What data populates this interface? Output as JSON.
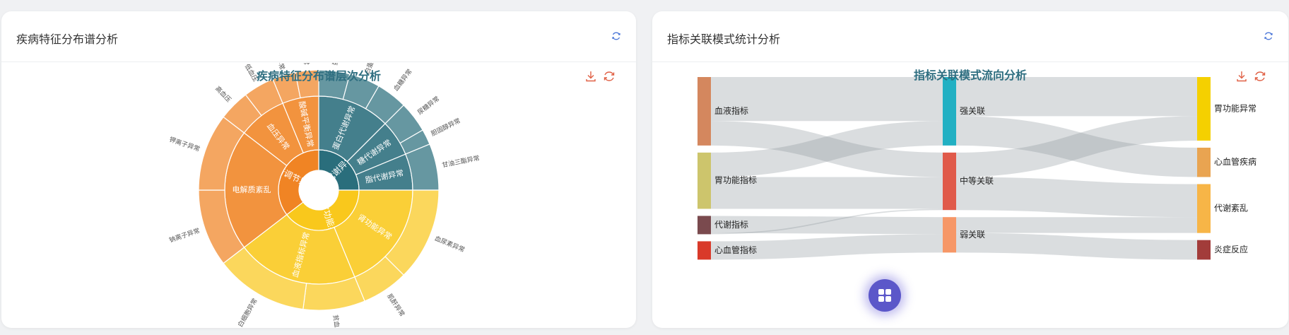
{
  "panels": {
    "left": {
      "title": "疾病特征分布谱分析"
    },
    "right": {
      "title": "指标关联模式统计分析"
    }
  },
  "icons": {
    "refresh": "refresh-icon",
    "download": "download-icon",
    "restore": "restore-icon",
    "apps": "apps-grid-icon"
  },
  "colors": {
    "accent": "#4a76d8",
    "toolbar_icon": "#e06045",
    "chart_title": "#2e6e80"
  },
  "chart_data": [
    {
      "type": "sunburst",
      "title": "疾病特征分布谱层次分析",
      "children": [
        {
          "name": "代谢异常",
          "color": "#2a6e7c",
          "value": 6,
          "children": [
            {
              "name": "蛋白代谢异常",
              "value": 3,
              "children": [
                {
                  "name": "蛋白尿",
                  "value": 1
                },
                {
                  "name": "白蛋白异常",
                  "value": 1
                },
                {
                  "name": "血糖异常",
                  "value": 1
                }
              ]
            },
            {
              "name": "糖代谢异常",
              "value": 1.5,
              "children": [
                {
                  "name": "尿糖异常",
                  "value": 1
                },
                {
                  "name": "胆固醇异常",
                  "value": 0.5
                }
              ]
            },
            {
              "name": "脂代谢异常",
              "value": 1.5,
              "children": [
                {
                  "name": "甘油三酯异常",
                  "value": 1.5
                }
              ]
            }
          ]
        },
        {
          "name": "器官功能异常",
          "color": "#f9c81c",
          "value": 9.5,
          "children": [
            {
              "name": "肾功能异常",
              "value": 4.5,
              "children": [
                {
                  "name": "血尿素异常",
                  "value": 3
                },
                {
                  "name": "肌酐异常",
                  "value": 1.5
                }
              ]
            },
            {
              "name": "血液指标异常",
              "value": 5,
              "children": [
                {
                  "name": "贫血",
                  "value": 2
                },
                {
                  "name": "白细胞异常",
                  "value": 3
                }
              ]
            }
          ]
        },
        {
          "name": "平衡调节异常",
          "color": "#f08424",
          "value": 8.5,
          "children": [
            {
              "name": "电解质紊乱",
              "value": 5,
              "children": [
                {
                  "name": "钠离子异常",
                  "value": 2.5
                },
                {
                  "name": "钾离子异常",
                  "value": 2.5
                }
              ]
            },
            {
              "name": "血压异常",
              "value": 2,
              "children": [
                {
                  "name": "高血压",
                  "value": 1
                },
                {
                  "name": "低血压",
                  "value": 1
                }
              ]
            },
            {
              "name": "酸碱平衡异常",
              "value": 1.5,
              "children": [
                {
                  "name": "pH异常",
                  "value": 0.75
                },
                {
                  "name": "碳酸异常",
                  "value": 0.75
                }
              ]
            }
          ]
        }
      ]
    },
    {
      "type": "sankey",
      "title": "指标关联模式流向分析",
      "nodes": [
        {
          "name": "血液指标",
          "color": "#d4875e",
          "column": 0
        },
        {
          "name": "胃功能指标",
          "color": "#cdc56c",
          "column": 0
        },
        {
          "name": "代谢指标",
          "color": "#7a4a4e",
          "column": 0
        },
        {
          "name": "心血管指标",
          "color": "#d93a2a",
          "column": 0
        },
        {
          "name": "强关联",
          "color": "#22b0c3",
          "column": 1
        },
        {
          "name": "中等关联",
          "color": "#e05a4a",
          "column": 1
        },
        {
          "name": "弱关联",
          "color": "#f69767",
          "column": 1
        },
        {
          "name": "胃功能异常",
          "color": "#f5d000",
          "column": 2
        },
        {
          "name": "心血管疾病",
          "color": "#e9a451",
          "column": 2
        },
        {
          "name": "代谢紊乱",
          "color": "#f7b547",
          "column": 2
        },
        {
          "name": "炎症反应",
          "color": "#a23c3a",
          "column": 2
        }
      ],
      "links": [
        {
          "source": "血液指标",
          "target": "强关联",
          "value": 36
        },
        {
          "source": "血液指标",
          "target": "中等关联",
          "value": 20
        },
        {
          "source": "胃功能指标",
          "target": "强关联",
          "value": 20
        },
        {
          "source": "胃功能指标",
          "target": "中等关联",
          "value": 26
        },
        {
          "source": "代谢指标",
          "target": "弱关联",
          "value": 14
        },
        {
          "source": "代谢指标",
          "target": "中等关联",
          "value": 1
        },
        {
          "source": "心血管指标",
          "target": "弱关联",
          "value": 15
        },
        {
          "source": "强关联",
          "target": "胃功能异常",
          "value": 32
        },
        {
          "source": "强关联",
          "target": "心血管疾病",
          "value": 24
        },
        {
          "source": "中等关联",
          "target": "胃功能异常",
          "value": 20
        },
        {
          "source": "中等关联",
          "target": "代谢紊乱",
          "value": 27
        },
        {
          "source": "弱关联",
          "target": "代谢紊乱",
          "value": 13
        },
        {
          "source": "弱关联",
          "target": "炎症反应",
          "value": 16
        }
      ]
    }
  ]
}
